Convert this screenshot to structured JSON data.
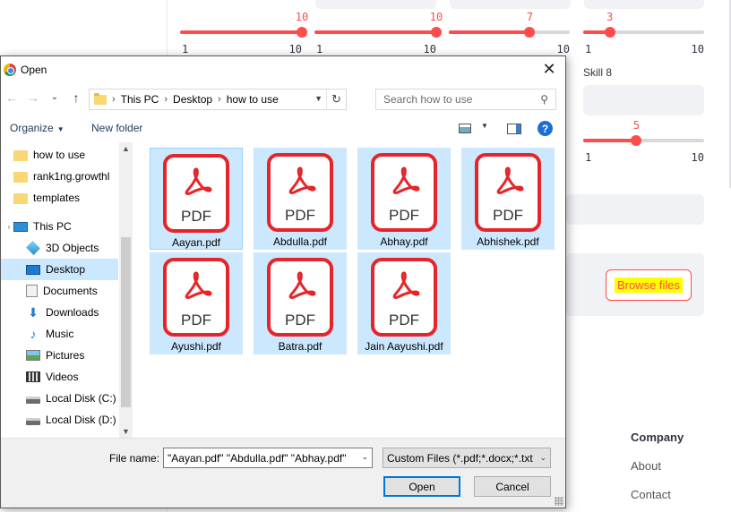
{
  "background": {
    "sliders": [
      {
        "value": "10",
        "min": "1",
        "max": "10",
        "fraction": 1.0
      },
      {
        "value": "10",
        "min": "1",
        "max": "10",
        "fraction": 1.0
      },
      {
        "value": "7",
        "min": "",
        "max": "10",
        "fraction": 0.667
      },
      {
        "value": "3",
        "min": "1",
        "max": "10",
        "fraction": 0.222
      },
      {
        "value": "5",
        "min": "1",
        "max": "10",
        "fraction": 0.444
      }
    ],
    "skill8_label": "Skill 8",
    "browse_label": "Browse files",
    "footer": {
      "heading": "Company",
      "links": [
        "About",
        "Contact"
      ]
    }
  },
  "dialog": {
    "title": "Open",
    "close_glyph": "✕",
    "nav_glyphs": {
      "back": "←",
      "forward": "→",
      "recent": "⌄",
      "up": "↑"
    },
    "breadcrumb": [
      "This PC",
      "Desktop",
      "how to use"
    ],
    "search_placeholder": "Search how to use",
    "toolbar": {
      "organize": "Organize",
      "new_folder": "New folder",
      "help": "?"
    },
    "nav_items": [
      {
        "label": "how to use",
        "icon": "folder-icon"
      },
      {
        "label": "rank1ng.growthl",
        "icon": "folder-icon"
      },
      {
        "label": "templates",
        "icon": "folder-icon"
      },
      {
        "label": "This PC",
        "icon": "computer-icon"
      },
      {
        "label": "3D Objects",
        "icon": "cube-icon"
      },
      {
        "label": "Desktop",
        "icon": "desktop-icon"
      },
      {
        "label": "Documents",
        "icon": "documents-icon"
      },
      {
        "label": "Downloads",
        "icon": "download-icon"
      },
      {
        "label": "Music",
        "icon": "music-icon"
      },
      {
        "label": "Pictures",
        "icon": "pictures-icon"
      },
      {
        "label": "Videos",
        "icon": "videos-icon"
      },
      {
        "label": "Local Disk (C:)",
        "icon": "disk-icon"
      },
      {
        "label": "Local Disk (D:)",
        "icon": "disk-icon"
      }
    ],
    "files": [
      {
        "name": "Aayan.pdf"
      },
      {
        "name": "Abdulla.pdf"
      },
      {
        "name": "Abhay.pdf"
      },
      {
        "name": "Abhishek.pdf"
      },
      {
        "name": "Ayushi.pdf"
      },
      {
        "name": "Batra.pdf"
      },
      {
        "name": "Jain Aayushi.pdf"
      }
    ],
    "pdf_label": "PDF",
    "file_name_label": "File name:",
    "file_name_value": "\"Aayan.pdf\" \"Abdulla.pdf\" \"Abhay.pdf\"",
    "file_type": "Custom Files (*.pdf;*.docx;*.txt",
    "open_label": "Open",
    "cancel_label": "Cancel",
    "colors": {
      "selection": "#cce8ff",
      "pdf_red": "#e5252a",
      "accent": "#ff4b4b"
    }
  }
}
